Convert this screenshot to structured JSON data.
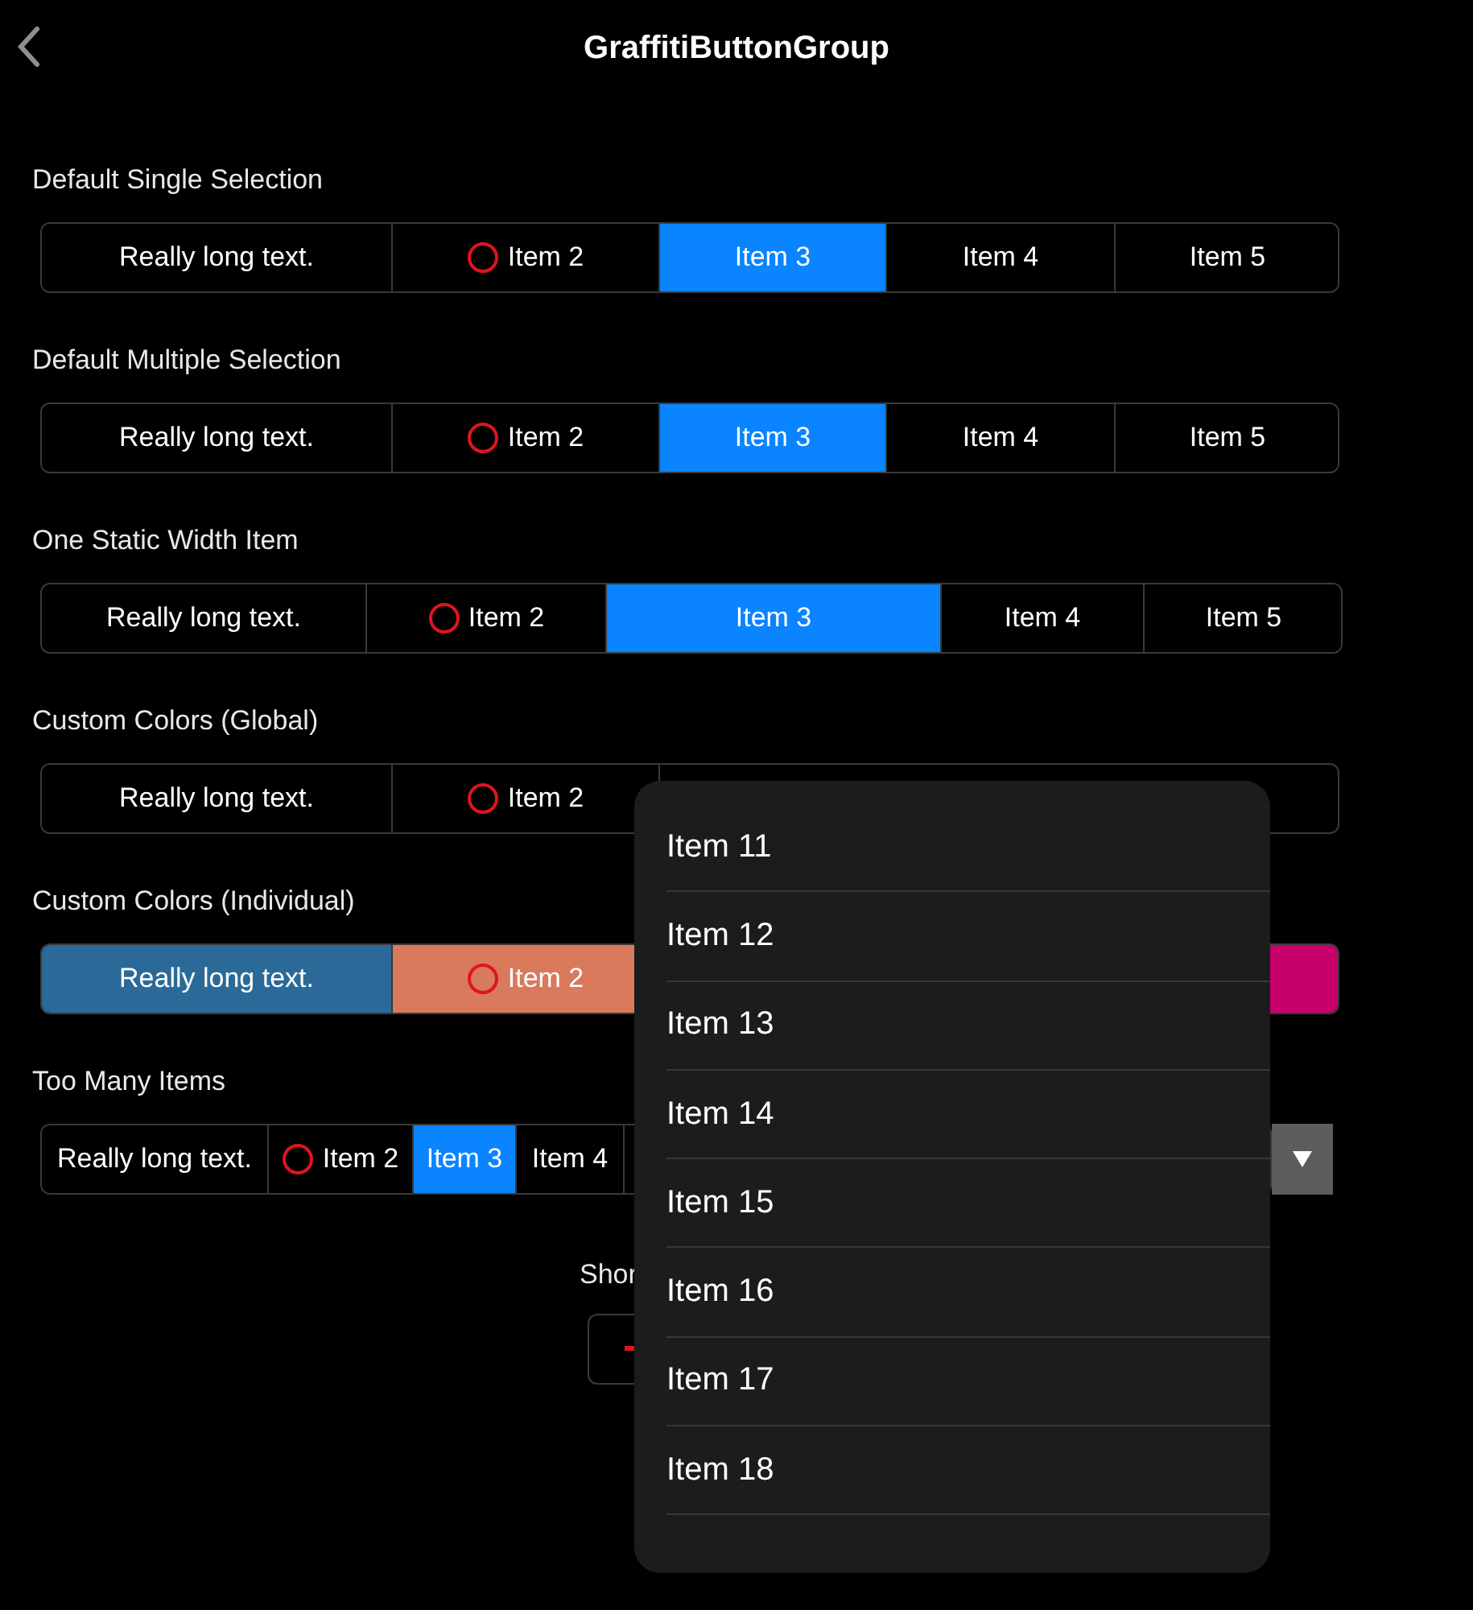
{
  "header": {
    "title": "GraffitiButtonGroup"
  },
  "sections": [
    {
      "title": "Default Single Selection",
      "kind": "group",
      "items": [
        {
          "label": "Really long text.",
          "icon": false,
          "selected": false
        },
        {
          "label": "Item 2",
          "icon": true,
          "selected": false
        },
        {
          "label": "Item 3",
          "icon": false,
          "selected": true
        },
        {
          "label": "Item 4",
          "icon": false,
          "selected": false
        },
        {
          "label": "Item 5",
          "icon": false,
          "selected": false
        }
      ]
    },
    {
      "title": "Default Multiple Selection",
      "kind": "group",
      "items": [
        {
          "label": "Really long text.",
          "icon": false,
          "selected": false
        },
        {
          "label": "Item 2",
          "icon": true,
          "selected": false
        },
        {
          "label": "Item 3",
          "icon": false,
          "selected": true
        },
        {
          "label": "Item 4",
          "icon": false,
          "selected": false
        },
        {
          "label": "Item 5",
          "icon": false,
          "selected": false
        }
      ]
    },
    {
      "title": "One Static Width Item",
      "kind": "group",
      "items": [
        {
          "label": "Really long text.",
          "icon": false,
          "selected": false
        },
        {
          "label": "Item 2",
          "icon": true,
          "selected": false
        },
        {
          "label": "Item 3",
          "icon": false,
          "selected": true
        },
        {
          "label": "Item 4",
          "icon": false,
          "selected": false
        },
        {
          "label": "Item 5",
          "icon": false,
          "selected": false
        }
      ]
    },
    {
      "title": "Custom Colors (Global)",
      "kind": "group",
      "items": [
        {
          "label": "Really long text.",
          "icon": false,
          "selected": false
        },
        {
          "label": "Item 2",
          "icon": true,
          "selected": false
        }
      ]
    },
    {
      "title": "Custom Colors (Individual)",
      "kind": "group",
      "items": [
        {
          "label": "Really long text.",
          "icon": false,
          "selected": false,
          "color": "#2b6a98"
        },
        {
          "label": "Item 2",
          "icon": true,
          "selected": false,
          "color": "#d97a5c"
        }
      ],
      "trailing": [
        {
          "color": "#c8006a"
        }
      ]
    },
    {
      "title": "Too Many Items",
      "kind": "overflow",
      "items": [
        {
          "label": "Really long text.",
          "icon": false,
          "selected": false
        },
        {
          "label": "Item 2",
          "icon": true,
          "selected": false
        },
        {
          "label": "Item 3",
          "icon": false,
          "selected": true
        },
        {
          "label": "Item 4",
          "icon": false,
          "selected": false
        }
      ]
    }
  ],
  "footer": {
    "text": "Shor"
  },
  "menu": {
    "items": [
      "Item 11",
      "Item 12",
      "Item 13",
      "Item 14",
      "Item 15",
      "Item 16",
      "Item 17",
      "Item 18"
    ]
  }
}
